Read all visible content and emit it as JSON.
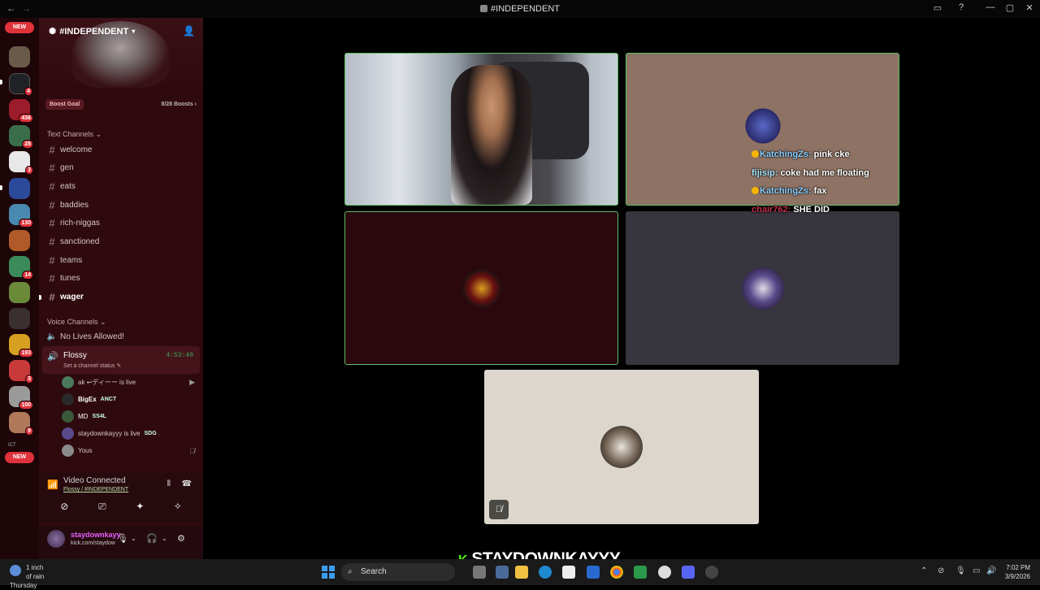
{
  "window": {
    "title": "#INDEPENDENT",
    "back": "←",
    "forward": "→",
    "controls": [
      "▭",
      "?",
      "—",
      "▢",
      "✕"
    ]
  },
  "rail": {
    "new_top": "NEW",
    "new_bottom": "NEW",
    "small_label": "ICT",
    "badges": [
      "4",
      "436",
      "28",
      "3",
      "130",
      "14",
      "193",
      "3",
      "100",
      "9"
    ]
  },
  "server": {
    "name": "#INDEPENDENT",
    "boost_goal": "Boost Goal",
    "boost_count": "8/28 Boosts"
  },
  "text_channels": {
    "header": "Text Channels",
    "items": [
      "welcome",
      "gen",
      "eats",
      "baddies",
      "rich-niggas",
      "sanctioned",
      "teams",
      "tunes",
      "wager"
    ]
  },
  "voice_channels": {
    "header": "Voice Channels",
    "no_lives": "No Lives Allowed!",
    "active": {
      "name": "Flossy",
      "timer": "4:53:40",
      "status": "Set a channel status"
    },
    "users": [
      {
        "name": "ak ↩ディーー is live",
        "tag": ""
      },
      {
        "name": "BigEx",
        "tag": "ANCT"
      },
      {
        "name": "MD",
        "tag": "SS4L"
      },
      {
        "name": "staydownkayyy is live",
        "tag": "SDG"
      },
      {
        "name": "Yous",
        "tag": ""
      }
    ]
  },
  "voice_panel": {
    "title": "Video Connected",
    "subtitle": "Flossy / #INDEPENDENT"
  },
  "user_panel": {
    "username": "staydownkayy",
    "status": "kick.com/staydow"
  },
  "chat_overlay": [
    {
      "user": "KatchingZs:",
      "msg": "pink cke",
      "cls": "u1",
      "badge": true
    },
    {
      "user": "fijisip:",
      "msg": "coke had me floating",
      "cls": "u2",
      "badge": false
    },
    {
      "user": "KatchingZs:",
      "msg": "fax",
      "cls": "u1",
      "badge": true
    },
    {
      "user": "chair762:",
      "msg": "SHE DID",
      "cls": "u3",
      "badge": false
    }
  ],
  "taskbar": {
    "weather_line1": "1 inch of rain",
    "weather_line2": "Thursday",
    "search": "Search",
    "time": "7:02 PM",
    "date": "3/9/2026"
  },
  "stream_brand": "STAYDOWNKAYYY",
  "colors": {
    "sidebar_bg": "#2e0a0f",
    "rail_bg": "#1d0508",
    "speaking_border": "#5fbf6a",
    "badge_red": "#e0323a",
    "tile_brown": "#8e7263",
    "tile_maroon": "#2a080d",
    "tile_slate": "#37353d",
    "tile_beige": "#dcd6cc"
  }
}
